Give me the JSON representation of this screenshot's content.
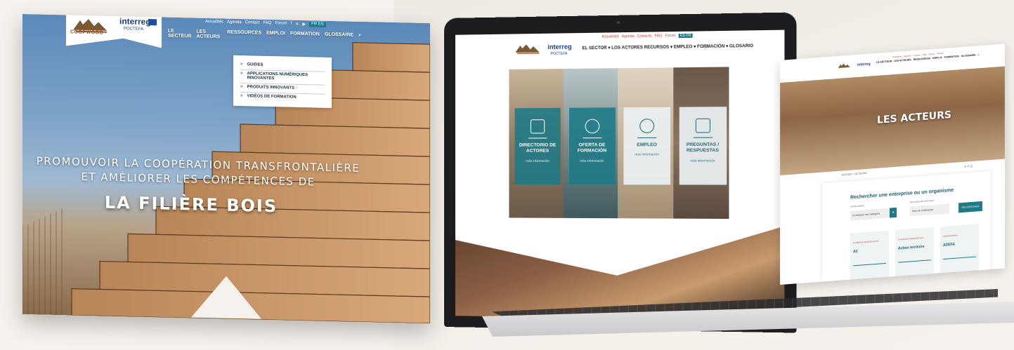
{
  "left_site": {
    "logo_text": "COOPWOOD",
    "partner": {
      "name": "interreg",
      "sub": "POCTEFA"
    },
    "top_links": [
      "Actualités",
      "Agenda",
      "Contact",
      "FAQ",
      "Forum"
    ],
    "lang": "FR ES",
    "nav": [
      "LE SECTEUR",
      "LES ACTEURS",
      "RESSOURCES",
      "EMPLOI",
      "FORMATION",
      "GLOSSAIRE"
    ],
    "dropdown": [
      "GUIDES",
      "APPLICATIONS NUMÉRIQUES INNOVANTES",
      "PRODUITS INNOVANTS",
      "VIDÉOS DE FORMATION"
    ],
    "hero_line1": "PROMOUVOIR LA COOPÉRATION TRANSFRONTALIÈRE",
    "hero_line2": "ET AMÉLIORER LES COMPÉTENCES DE",
    "hero_big": "LA FILIÈRE BOIS"
  },
  "laptop_site": {
    "logo_text": "COOPWOOD",
    "partner": {
      "name": "interreg",
      "sub": "POCTEFA"
    },
    "top_links": [
      "Actualidad",
      "Agenda",
      "Contacto",
      "FAQ",
      "Forum"
    ],
    "lang": "ES FR",
    "nav": "EL SECTOR ▾ LOS ACTORES RECURSOS ▾ EMPLEO ▾ FORMACIÓN ▾ GLOSARIO",
    "cards": [
      {
        "title": "DIRECTORIO DE ACTORES",
        "link": "más información",
        "style": "teal"
      },
      {
        "title": "OFERTA DE FORMACIÓN",
        "link": "más información",
        "style": "teal"
      },
      {
        "title": "EMPLEO",
        "link": "más información",
        "style": "light"
      },
      {
        "title": "PREGUNTAS / RESPUESTAS",
        "link": "más información",
        "style": "light"
      }
    ]
  },
  "right_site": {
    "partner": {
      "name": "interreg"
    },
    "top_links": [
      "Actualités",
      "Agenda",
      "Contact",
      "FAQ",
      "Forum"
    ],
    "lang": "FR ES",
    "nav": [
      "LE SECTEUR",
      "LES ACTEURS",
      "RESSOURCES",
      "EMPLOI",
      "FORMATION",
      "GLOSSAIRE"
    ],
    "hero_title": "LES ACTEURS",
    "breadcrumb": "ACCUEIL > ACTEURS",
    "search": {
      "title": "Rechercher une entreprise ou un organisme",
      "cat_label": "CATÉGORIES :",
      "cat_value": "Choisissez une catégorie",
      "name_label": "RECHERCHE PAR NOM :",
      "name_placeholder": "Nom de l'entreprise",
      "button": "RECHERCHER"
    },
    "cards": [
      {
        "tag": "SYNDICAT ASSOCIATION",
        "name": "A3"
      },
      {
        "tag": "SYNDICAT ASSOCIATION",
        "name": "Action territoire"
      },
      {
        "tag": "ASSOCIATION",
        "name": "ADEFA"
      }
    ]
  },
  "colors": {
    "teal": "#1d7a87",
    "brand_blue": "#1b3e8a",
    "accent_red": "#c0442b",
    "background": "#f5f1ec"
  }
}
